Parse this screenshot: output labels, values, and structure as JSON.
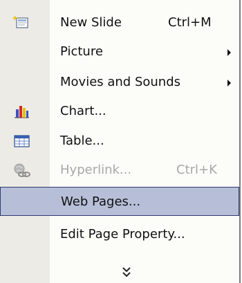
{
  "menu": {
    "items": [
      {
        "label": "New Slide",
        "shortcut": "Ctrl+M",
        "icon": "new-slide-icon",
        "submenu": false,
        "disabled": false,
        "highlighted": false
      },
      {
        "label": "Picture",
        "shortcut": "",
        "icon": "",
        "submenu": true,
        "disabled": false,
        "highlighted": false
      },
      {
        "label": "Movies and Sounds",
        "shortcut": "",
        "icon": "",
        "submenu": true,
        "disabled": false,
        "highlighted": false
      },
      {
        "label": "Chart...",
        "shortcut": "",
        "icon": "chart-icon",
        "submenu": false,
        "disabled": false,
        "highlighted": false
      },
      {
        "label": "Table...",
        "shortcut": "",
        "icon": "table-icon",
        "submenu": false,
        "disabled": false,
        "highlighted": false
      },
      {
        "label": "Hyperlink...",
        "shortcut": "Ctrl+K",
        "icon": "hyperlink-icon",
        "submenu": false,
        "disabled": true,
        "highlighted": false
      },
      {
        "label": "Web Pages...",
        "shortcut": "",
        "icon": "",
        "submenu": false,
        "disabled": false,
        "highlighted": true
      },
      {
        "label": "Edit Page Property...",
        "shortcut": "",
        "icon": "",
        "submenu": false,
        "disabled": false,
        "highlighted": false
      }
    ],
    "expand_icon": "double-chevron-down-icon"
  },
  "colors": {
    "menu_background": "#fcfcf9",
    "gutter": "#ecebe6",
    "highlight_fill": "#b7bfd8",
    "highlight_border": "#2d3a6e",
    "disabled_text": "#a8a8a8"
  }
}
